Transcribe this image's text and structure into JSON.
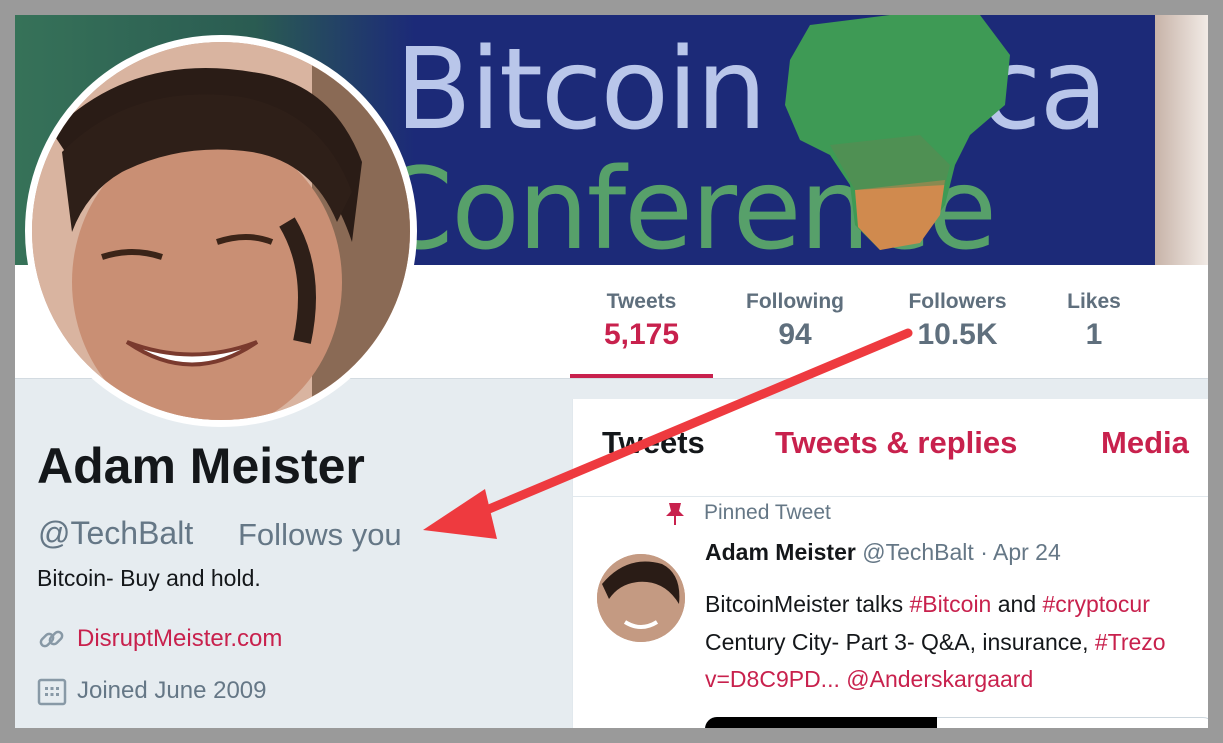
{
  "banner": {
    "text_line_1": "Bitcoin Africa",
    "text_line_2": "Conference"
  },
  "stats": [
    {
      "label": "Tweets",
      "value": "5,175",
      "active": true
    },
    {
      "label": "Following",
      "value": "94",
      "active": false
    },
    {
      "label": "Followers",
      "value": "10.5K",
      "active": false
    },
    {
      "label": "Likes",
      "value": "1",
      "active": false
    }
  ],
  "profile": {
    "name": "Adam Meister",
    "handle": "@TechBalt",
    "follows_you": "Follows you",
    "bio": "Bitcoin- Buy and hold.",
    "website": "DisruptMeister.com",
    "joined": "Joined June 2009"
  },
  "timeline": {
    "tabs": [
      "Tweets",
      "Tweets & replies",
      "Media"
    ],
    "pinned_label": "Pinned Tweet",
    "tweet": {
      "author": "Adam Meister",
      "handle": "@TechBalt",
      "separator": "·",
      "date": "Apr 24",
      "line1_a": "BitcoinMeister talks ",
      "line1_tag1": "#Bitcoin",
      "line1_b": " and ",
      "line1_tag2": "#cryptocur",
      "line2_a": "Century City- Part 3- Q&A, insurance, ",
      "line2_tag": "#Trezo",
      "line3_link": "v=D8C9PD...",
      "line3_mention": "@Anderskargaard"
    }
  },
  "colors": {
    "accent": "#c8214d",
    "muted": "#657786",
    "annotation_arrow": "#ee3a3f"
  },
  "icons": [
    "link-icon",
    "calendar-icon",
    "pin-icon",
    "arrow-icon"
  ]
}
